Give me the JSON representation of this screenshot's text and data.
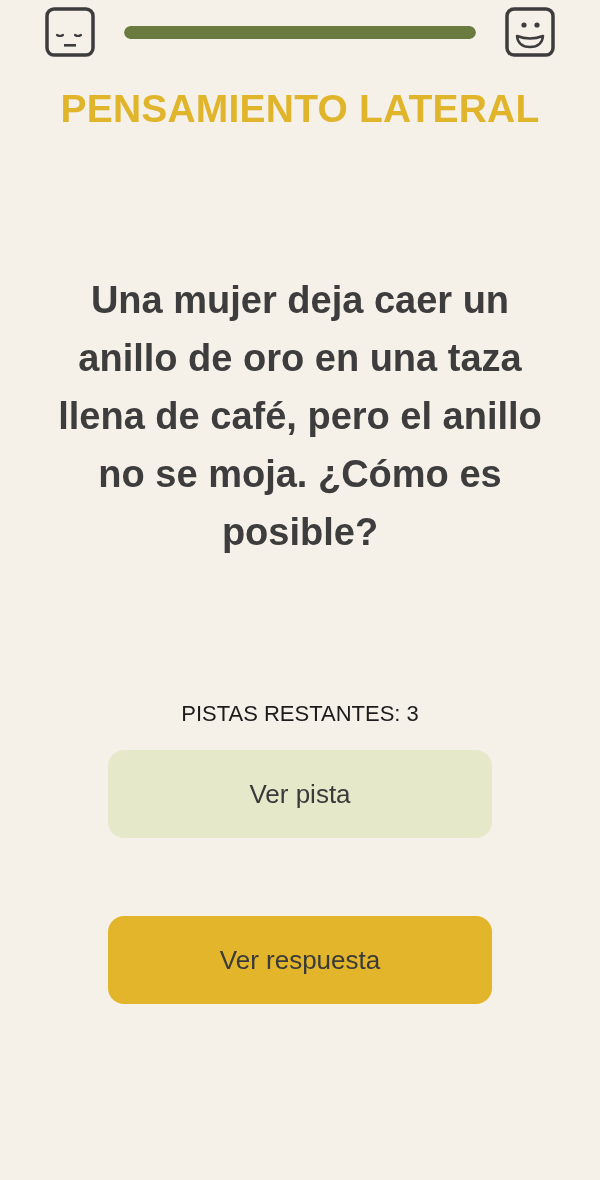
{
  "progress": {
    "level": 1
  },
  "title": "PENSAMIENTO LATERAL",
  "question": "Una mujer deja caer un anillo de oro en una taza llena de café, pero el anillo no se moja. ¿Cómo es posible?",
  "hints_remaining": "PISTAS RESTANTES: 3",
  "buttons": [
    {
      "label": "Ver pista",
      "kind": "hint"
    },
    {
      "label": "Ver respuesta",
      "kind": "answer"
    }
  ]
}
